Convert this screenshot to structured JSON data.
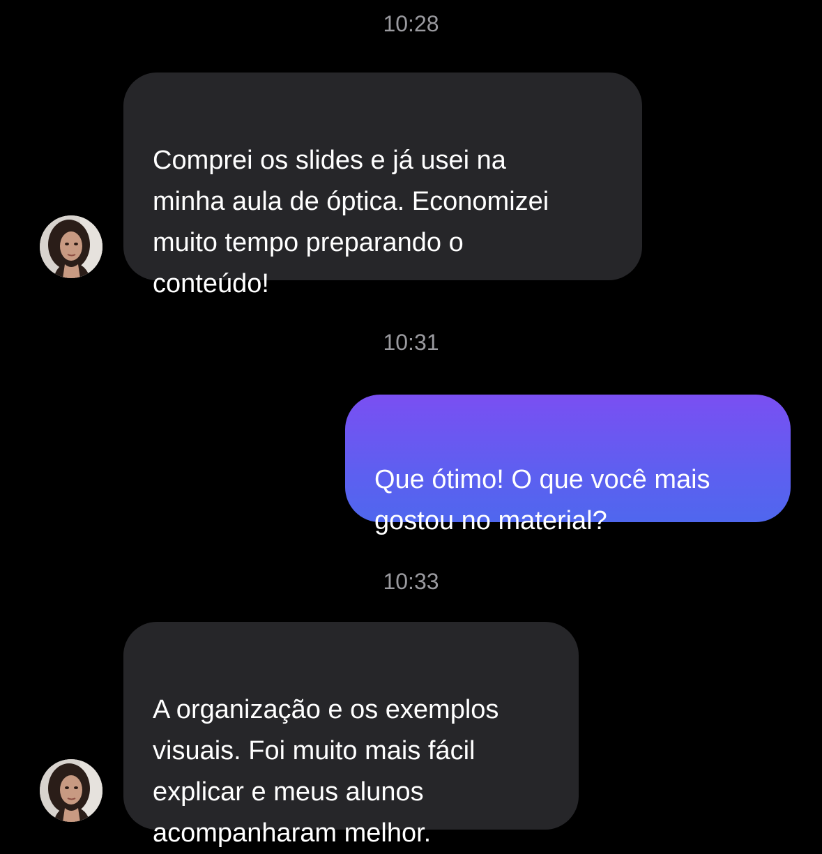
{
  "conversation": {
    "messages": [
      {
        "time": "10:28",
        "direction": "incoming",
        "text": "Comprei os slides e já usei na\nminha aula de óptica. Economizei\nmuito tempo preparando o\nconteúdo!"
      },
      {
        "time": "10:31",
        "direction": "outgoing",
        "text": "Que ótimo! O que você mais\ngostou no material?"
      },
      {
        "time": "10:33",
        "direction": "incoming",
        "text": "A organização e os exemplos\nvisuais. Foi muito mais fácil\nexplicar e meus alunos\nacompanharam melhor."
      }
    ]
  },
  "theme": {
    "background": "#000000",
    "incoming_bubble": "#262629",
    "outgoing_gradient_top": "#7a4ff2",
    "outgoing_gradient_bottom": "#4f67ee",
    "timestamp_color": "#9a9a9f"
  },
  "icons": {
    "avatar": "contact-avatar-photo"
  }
}
